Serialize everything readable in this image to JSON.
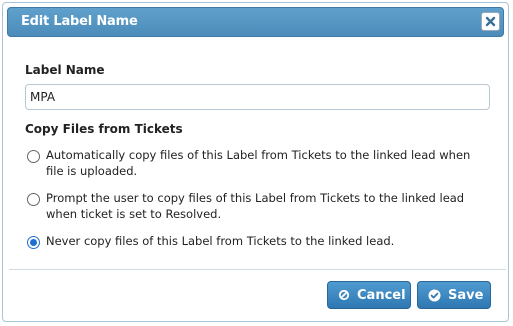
{
  "dialog": {
    "title": "Edit Label Name",
    "close_icon": "close-icon"
  },
  "label_name": {
    "heading": "Label Name",
    "value": "MPA"
  },
  "copy_files": {
    "heading": "Copy Files from Tickets",
    "options": [
      {
        "text": "Automatically copy files of this Label from Tickets to the linked lead when file is uploaded.",
        "checked": false
      },
      {
        "text": "Prompt the user to copy files of this Label from Tickets to the linked lead when ticket is set to Resolved.",
        "checked": false
      },
      {
        "text": "Never copy files of this Label from Tickets to the linked lead.",
        "checked": true
      }
    ]
  },
  "buttons": {
    "cancel_label": "Cancel",
    "cancel_icon": "ban-icon",
    "save_label": "Save",
    "save_icon": "check-circle-icon"
  },
  "colors": {
    "titlebar": "#4b8cba",
    "button": "#2f78b3",
    "radio_selected": "#1f6fd1"
  }
}
